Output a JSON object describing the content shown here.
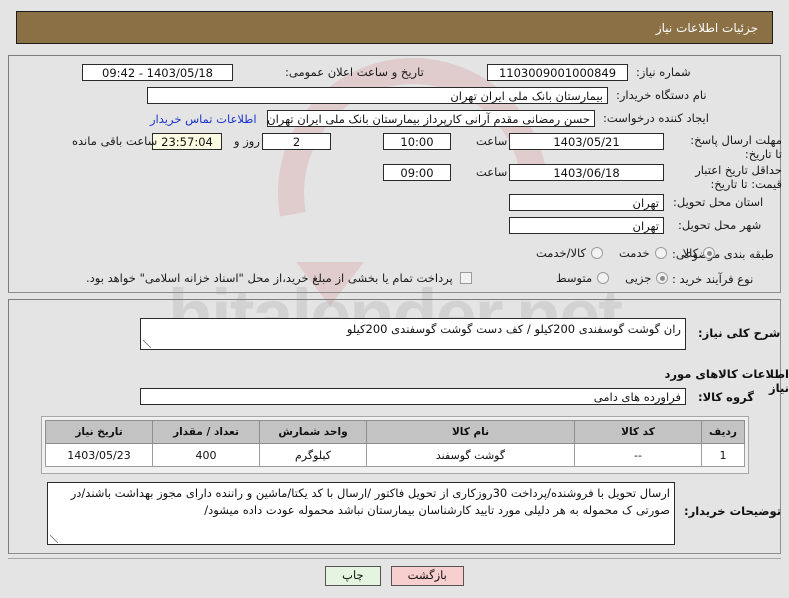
{
  "header": {
    "title": "جزئیات اطلاعات نیاز"
  },
  "watermark": {
    "text": "hitalender.net"
  },
  "form": {
    "need_number_label": "شماره نیاز:",
    "need_number_value": "1103009001000849",
    "public_announce_label": "تاریخ و ساعت اعلان عمومی:",
    "public_announce_value": "1403/05/18 - 09:42",
    "buyer_org_label": "نام دستگاه خریدار:",
    "buyer_org_value": "بیمارستان بانک ملی ایران تهران",
    "creator_label": "ایجاد کننده درخواست:",
    "creator_value": "حسن رمضانی مقدم آرانی کارپرداز بیمارستان بانک ملی ایران تهران",
    "contact_link": "اطلاعات تماس خریدار",
    "deadline_label": "مهلت ارسال پاسخ: تا تاریخ:",
    "deadline_date": "1403/05/21",
    "hour_label": "ساعت",
    "deadline_time": "10:00",
    "days_value": "2",
    "days_label": "روز و",
    "countdown_value": "23:57:04",
    "countdown_label": "ساعت باقی مانده",
    "price_validity_label": "حداقل تاریخ اعتبار قیمت: تا تاریخ:",
    "price_validity_date": "1403/06/18",
    "price_validity_time": "09:00",
    "province_label": "استان محل تحویل:",
    "province_value": "تهران",
    "city_label": "شهر محل تحویل:",
    "city_value": "تهران",
    "category_label": "طبقه بندی موضوعی:",
    "category_options": [
      {
        "label": "کالا",
        "selected": true
      },
      {
        "label": "خدمت",
        "selected": false
      },
      {
        "label": "کالا/خدمت",
        "selected": false
      }
    ],
    "process_label": "نوع فرآیند خرید :",
    "process_options": [
      {
        "label": "جزیی",
        "selected": true
      },
      {
        "label": "متوسط",
        "selected": false
      }
    ],
    "treasury_checkbox_label": "پرداخت تمام یا بخشی از مبلغ خرید،از محل \"اسناد خزانه اسلامی\" خواهد بود.",
    "treasury_checked": false
  },
  "body": {
    "summary_label": "شرح کلی نیاز:",
    "summary_value": "ران گوشت گوسفندی 200کیلو / کف دست گوشت گوسفندی 200کیلو",
    "goods_section_title": "اطلاعات کالاهای مورد نیاز",
    "group_label": "گروه کالا:",
    "group_value": "فراورده های دامی",
    "notes_label": "توضیحات خریدار:",
    "notes_value": "ارسال تحویل با فروشنده/پرداخت 30روزکاری از تحویل فاکتور /ارسال با کد یکتا/ماشین و راننده دارای مجوز بهداشت باشند/در صورتی ک محموله به هر دلیلی مورد تایید کارشناسان بیمارستان نباشد محموله عودت داده میشود/"
  },
  "table": {
    "columns": [
      "ردیف",
      "کد کالا",
      "نام کالا",
      "واحد شمارش",
      "تعداد / مقدار",
      "تاریخ نیاز"
    ],
    "rows": [
      {
        "row": "1",
        "code": "--",
        "name": "گوشت گوسفند",
        "unit": "کیلوگرم",
        "qty": "400",
        "date": "1403/05/23"
      }
    ]
  },
  "buttons": {
    "back": "بازگشت",
    "print": "چاپ"
  },
  "colors": {
    "title_bar": "#8b6f45",
    "link": "#1a34c8",
    "back_button": "#f8cfcf",
    "print_button": "#e4f4e0",
    "countdown_field": "#fbfbe4",
    "table_header": "#c3c3c3"
  }
}
